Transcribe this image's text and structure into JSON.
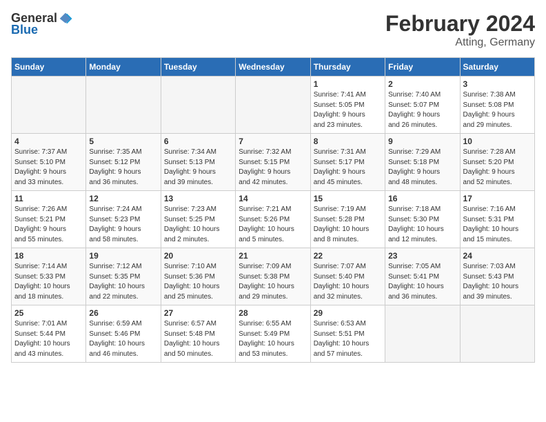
{
  "header": {
    "logo_general": "General",
    "logo_blue": "Blue",
    "title": "February 2024",
    "subtitle": "Atting, Germany"
  },
  "calendar": {
    "days_of_week": [
      "Sunday",
      "Monday",
      "Tuesday",
      "Wednesday",
      "Thursday",
      "Friday",
      "Saturday"
    ],
    "weeks": [
      [
        {
          "day": "",
          "info": ""
        },
        {
          "day": "",
          "info": ""
        },
        {
          "day": "",
          "info": ""
        },
        {
          "day": "",
          "info": ""
        },
        {
          "day": "1",
          "info": "Sunrise: 7:41 AM\nSunset: 5:05 PM\nDaylight: 9 hours\nand 23 minutes."
        },
        {
          "day": "2",
          "info": "Sunrise: 7:40 AM\nSunset: 5:07 PM\nDaylight: 9 hours\nand 26 minutes."
        },
        {
          "day": "3",
          "info": "Sunrise: 7:38 AM\nSunset: 5:08 PM\nDaylight: 9 hours\nand 29 minutes."
        }
      ],
      [
        {
          "day": "4",
          "info": "Sunrise: 7:37 AM\nSunset: 5:10 PM\nDaylight: 9 hours\nand 33 minutes."
        },
        {
          "day": "5",
          "info": "Sunrise: 7:35 AM\nSunset: 5:12 PM\nDaylight: 9 hours\nand 36 minutes."
        },
        {
          "day": "6",
          "info": "Sunrise: 7:34 AM\nSunset: 5:13 PM\nDaylight: 9 hours\nand 39 minutes."
        },
        {
          "day": "7",
          "info": "Sunrise: 7:32 AM\nSunset: 5:15 PM\nDaylight: 9 hours\nand 42 minutes."
        },
        {
          "day": "8",
          "info": "Sunrise: 7:31 AM\nSunset: 5:17 PM\nDaylight: 9 hours\nand 45 minutes."
        },
        {
          "day": "9",
          "info": "Sunrise: 7:29 AM\nSunset: 5:18 PM\nDaylight: 9 hours\nand 48 minutes."
        },
        {
          "day": "10",
          "info": "Sunrise: 7:28 AM\nSunset: 5:20 PM\nDaylight: 9 hours\nand 52 minutes."
        }
      ],
      [
        {
          "day": "11",
          "info": "Sunrise: 7:26 AM\nSunset: 5:21 PM\nDaylight: 9 hours\nand 55 minutes."
        },
        {
          "day": "12",
          "info": "Sunrise: 7:24 AM\nSunset: 5:23 PM\nDaylight: 9 hours\nand 58 minutes."
        },
        {
          "day": "13",
          "info": "Sunrise: 7:23 AM\nSunset: 5:25 PM\nDaylight: 10 hours\nand 2 minutes."
        },
        {
          "day": "14",
          "info": "Sunrise: 7:21 AM\nSunset: 5:26 PM\nDaylight: 10 hours\nand 5 minutes."
        },
        {
          "day": "15",
          "info": "Sunrise: 7:19 AM\nSunset: 5:28 PM\nDaylight: 10 hours\nand 8 minutes."
        },
        {
          "day": "16",
          "info": "Sunrise: 7:18 AM\nSunset: 5:30 PM\nDaylight: 10 hours\nand 12 minutes."
        },
        {
          "day": "17",
          "info": "Sunrise: 7:16 AM\nSunset: 5:31 PM\nDaylight: 10 hours\nand 15 minutes."
        }
      ],
      [
        {
          "day": "18",
          "info": "Sunrise: 7:14 AM\nSunset: 5:33 PM\nDaylight: 10 hours\nand 18 minutes."
        },
        {
          "day": "19",
          "info": "Sunrise: 7:12 AM\nSunset: 5:35 PM\nDaylight: 10 hours\nand 22 minutes."
        },
        {
          "day": "20",
          "info": "Sunrise: 7:10 AM\nSunset: 5:36 PM\nDaylight: 10 hours\nand 25 minutes."
        },
        {
          "day": "21",
          "info": "Sunrise: 7:09 AM\nSunset: 5:38 PM\nDaylight: 10 hours\nand 29 minutes."
        },
        {
          "day": "22",
          "info": "Sunrise: 7:07 AM\nSunset: 5:40 PM\nDaylight: 10 hours\nand 32 minutes."
        },
        {
          "day": "23",
          "info": "Sunrise: 7:05 AM\nSunset: 5:41 PM\nDaylight: 10 hours\nand 36 minutes."
        },
        {
          "day": "24",
          "info": "Sunrise: 7:03 AM\nSunset: 5:43 PM\nDaylight: 10 hours\nand 39 minutes."
        }
      ],
      [
        {
          "day": "25",
          "info": "Sunrise: 7:01 AM\nSunset: 5:44 PM\nDaylight: 10 hours\nand 43 minutes."
        },
        {
          "day": "26",
          "info": "Sunrise: 6:59 AM\nSunset: 5:46 PM\nDaylight: 10 hours\nand 46 minutes."
        },
        {
          "day": "27",
          "info": "Sunrise: 6:57 AM\nSunset: 5:48 PM\nDaylight: 10 hours\nand 50 minutes."
        },
        {
          "day": "28",
          "info": "Sunrise: 6:55 AM\nSunset: 5:49 PM\nDaylight: 10 hours\nand 53 minutes."
        },
        {
          "day": "29",
          "info": "Sunrise: 6:53 AM\nSunset: 5:51 PM\nDaylight: 10 hours\nand 57 minutes."
        },
        {
          "day": "",
          "info": ""
        },
        {
          "day": "",
          "info": ""
        }
      ]
    ]
  }
}
